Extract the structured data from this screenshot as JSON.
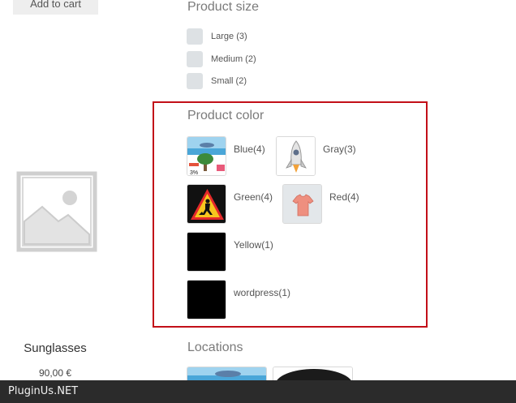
{
  "left": {
    "add_to_cart": "Add to cart",
    "product_name": "Sunglasses",
    "product_price": "90,00 €"
  },
  "filters": {
    "size_title": "Product size",
    "sizes": [
      {
        "label": "Large (3)"
      },
      {
        "label": "Medium (2)"
      },
      {
        "label": "Small (2)"
      }
    ],
    "color_title": "Product color",
    "colors": [
      {
        "label": "Blue(4)",
        "icon": "beach-scene-thumbnail"
      },
      {
        "label": "Gray(3)",
        "icon": "rocket-thumbnail"
      },
      {
        "label": "Green(4)",
        "icon": "road-work-sign-thumbnail"
      },
      {
        "label": "Red(4)",
        "icon": "tshirt-thumbnail"
      },
      {
        "label": "Yellow(1)",
        "icon": "black-thumbnail"
      },
      {
        "label": "wordpress(1)",
        "icon": "black-thumbnail"
      }
    ],
    "locations_title": "Locations",
    "highlight_color": "#c20f18"
  },
  "footer": {
    "text": "PluginUs.NET"
  }
}
